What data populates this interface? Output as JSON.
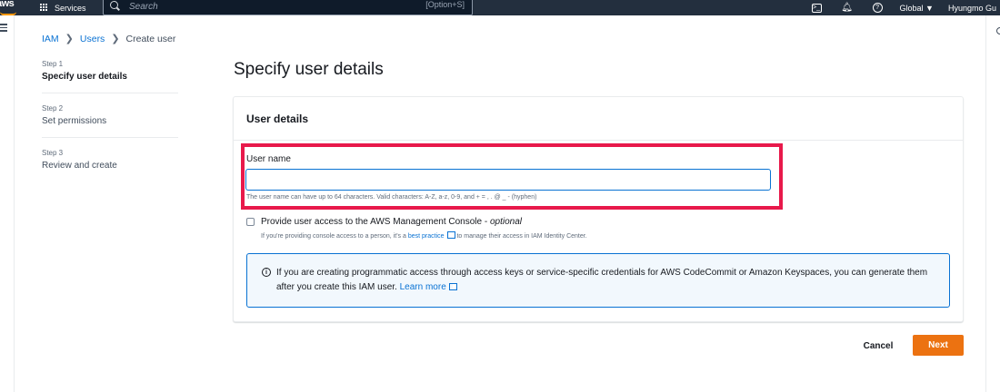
{
  "topnav": {
    "logo": "aws",
    "services_label": "Services",
    "search_placeholder": "Search",
    "search_shortcut": "[Option+S]",
    "region_label": "Global ▼",
    "user_label": "Hyungmo Gu"
  },
  "breadcrumb": {
    "items": [
      {
        "label": "IAM"
      },
      {
        "label": "Users"
      }
    ],
    "current": "Create user"
  },
  "steps": [
    {
      "number": "Step 1",
      "label": "Specify user details",
      "active": true
    },
    {
      "number": "Step 2",
      "label": "Set permissions",
      "active": false
    },
    {
      "number": "Step 3",
      "label": "Review and create",
      "active": false
    }
  ],
  "page_title": "Specify user details",
  "container": {
    "title": "User details",
    "field_label": "User name",
    "field_value": "",
    "field_hint": "The user name can have up to 64 characters. Valid characters: A-Z, a-z, 0-9, and + = , . @ _ - (hyphen)",
    "checkbox_label": "Provide user access to the AWS Management Console - ",
    "checkbox_optional": "optional",
    "checkbox_desc_before": "If you're providing console access to a person, it's a ",
    "checkbox_desc_link": "best practice",
    "checkbox_desc_after": " to manage their access in IAM Identity Center.",
    "alert_text": "If you are creating programmatic access through access keys or service-specific credentials for AWS CodeCommit or Amazon Keyspaces, you can generate them after you create this IAM user. ",
    "alert_link": "Learn more"
  },
  "buttons": {
    "cancel": "Cancel",
    "next": "Next"
  },
  "colors": {
    "nav_bg": "#232f3e",
    "link": "#0972d3",
    "primary_button": "#ec7211",
    "highlight": "#e8194b"
  }
}
